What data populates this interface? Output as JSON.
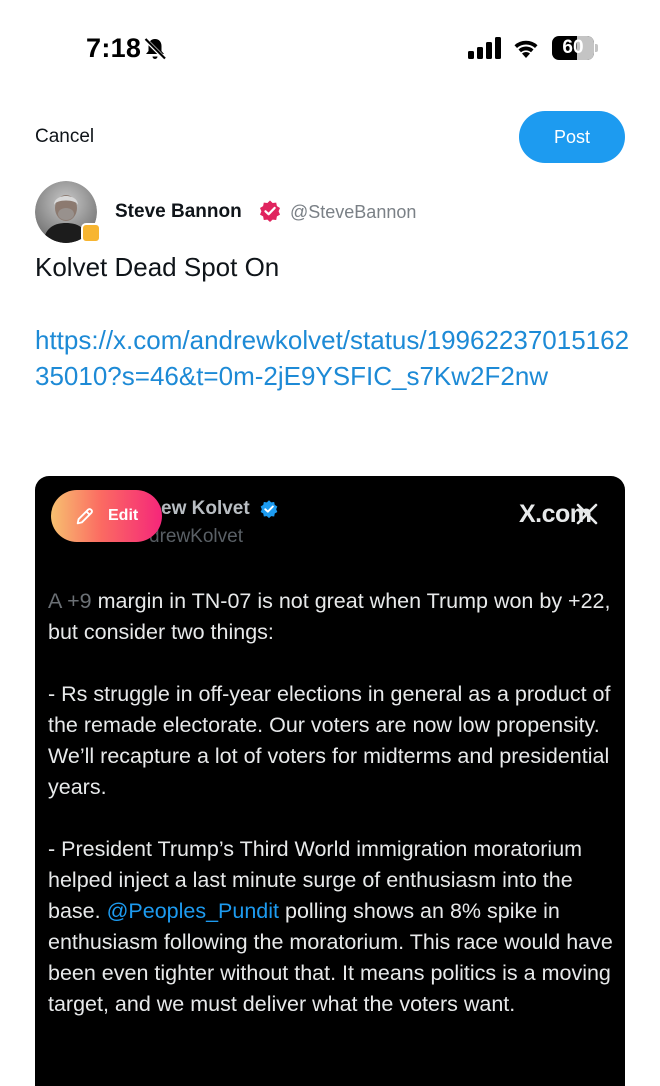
{
  "status_bar": {
    "time": "7:18",
    "battery_level": "60",
    "battery_fraction": 0.6,
    "icons": [
      "bell-slash-icon",
      "signal-icon",
      "wifi-icon",
      "battery-icon"
    ]
  },
  "compose": {
    "cancel_label": "Cancel",
    "post_label": "Post",
    "accent_color": "#1d9bf0"
  },
  "author": {
    "display_name": "Steve Bannon",
    "handle": "@SteveBannon",
    "badge_color": "#e0245e"
  },
  "post": {
    "text": "Kolvet Dead Spot On",
    "link": "https://x.com/andrewkolvet/status/1996223701516235010?s=46&t=0m-2jE9YSFIC_s7Kw2F2nw"
  },
  "embedded": {
    "author_partial": "ew Kolvet",
    "handle_partial": "drewKolvet",
    "site_label": "X.com",
    "body_faded": "A +9",
    "body_lead": " margin in TN-07 is not great when Trump won by +22, but consider two things:",
    "paragraph_2": "- Rs struggle in off-year elections in general as a product of the remade electorate. Our voters are now low propensity. We’ll recapture a lot of voters for midterms and presidential years.",
    "paragraph_3_before": "- President Trump’s Third World immigration moratorium helped inject a last minute surge of enthusiasm into the base. ",
    "mention": "@Peoples_Pundit",
    "paragraph_3_after": " polling shows an 8% spike in enthusiasm following the moratorium. This race would have been even tighter without that. It means politics is a moving target, and we must deliver what the voters want."
  },
  "edit_button": {
    "label": "Edit"
  }
}
